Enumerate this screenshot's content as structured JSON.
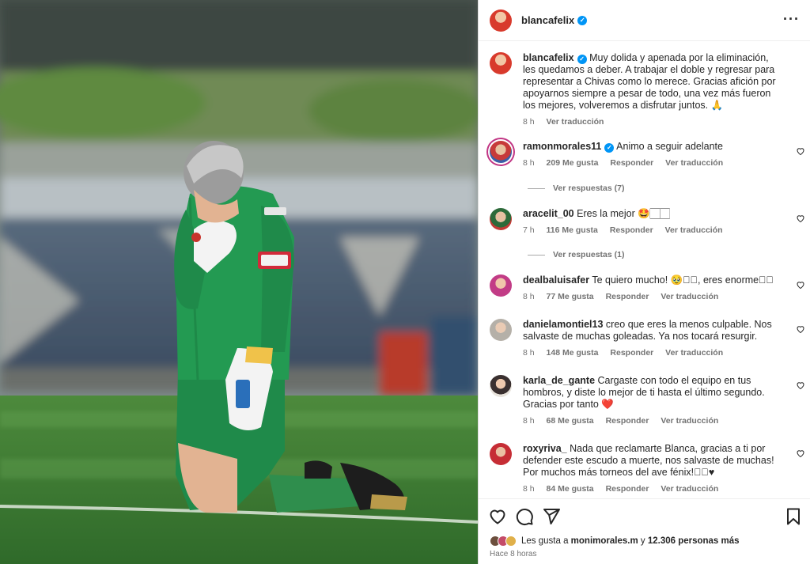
{
  "post": {
    "username": "blancafelix",
    "more_icon": "more-icon"
  },
  "caption": {
    "username": "blancafelix",
    "text": "Muy dolida y apenada por la eliminación, les quedamos a deber. A trabajar el doble y regresar para representar a Chivas como lo merece. Gracias afición por apoyarnos siempre a pesar de todo, una vez más fueron los mejores, volveremos a disfrutar juntos. 🙏",
    "time": "8 h",
    "translate": "Ver traducción"
  },
  "comments": [
    {
      "username": "ramonmorales11",
      "verified": true,
      "text": "Animo a seguir adelante",
      "time": "8 h",
      "likes": "209 Me gusta",
      "reply": "Responder",
      "translate": "Ver traducción",
      "replies": "Ver respuestas (7)"
    },
    {
      "username": "aracelit_00",
      "verified": false,
      "text": "Eres la mejor 🤩🏻🏻",
      "time": "7 h",
      "likes": "116 Me gusta",
      "reply": "Responder",
      "translate": "Ver traducción",
      "replies": "Ver respuestas (1)"
    },
    {
      "username": "dealbaluisafer",
      "verified": false,
      "text": "Te quiero mucho! 🥹🏻🏻, eres enorme🏻🏻",
      "time": "8 h",
      "likes": "77 Me gusta",
      "reply": "Responder",
      "translate": "Ver traducción"
    },
    {
      "username": "danielamontiel13",
      "verified": false,
      "text": "creo que eres la menos culpable. Nos salvaste de muchas goleadas. Ya nos tocará resurgir.",
      "time": "8 h",
      "likes": "148 Me gusta",
      "reply": "Responder",
      "translate": "Ver traducción"
    },
    {
      "username": "karla_de_gante",
      "verified": false,
      "text": "Cargaste con todo el equipo en tus hombros, y diste lo mejor de ti hasta el último segundo. Gracias por tanto ❤️",
      "time": "8 h",
      "likes": "68 Me gusta",
      "reply": "Responder",
      "translate": "Ver traducción"
    },
    {
      "username": "roxyriva_",
      "verified": false,
      "text": "Nada que reclamarte Blanca, gracias a ti por defender este escudo a muerte, nos salvaste de muchas! Por muchos más torneos del ave fénix!🏻🏻♥",
      "time": "8 h",
      "likes": "84 Me gusta",
      "reply": "Responder",
      "translate": "Ver traducción"
    }
  ],
  "actions": {
    "like_icon": "heart-icon",
    "comment_icon": "comment-icon",
    "share_icon": "share-icon",
    "save_icon": "bookmark-icon"
  },
  "likes_summary": {
    "prefix": "Les gusta a",
    "user": "monimorales.m",
    "middle": "y",
    "others": "12.306 personas más"
  },
  "timestamp": "Hace 8 horas",
  "colors": {
    "verified": "#0095f6",
    "secondary_text": "#737373",
    "jersey_green": "#1f8a4a",
    "pitch_green": "#3c7b34"
  }
}
